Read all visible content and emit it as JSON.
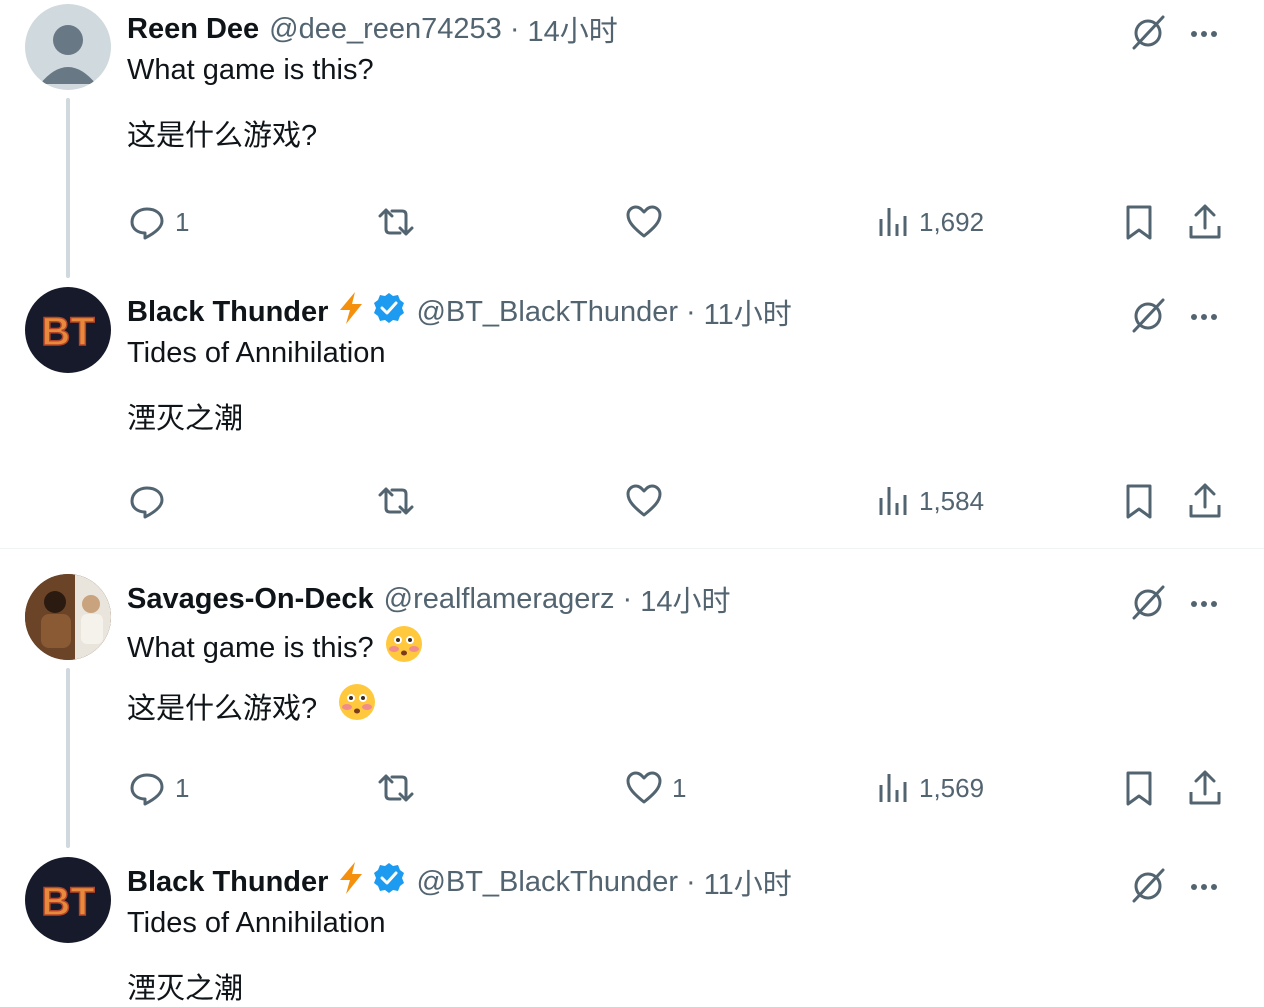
{
  "colors": {
    "icon_gray": "#536471",
    "verified_blue": "#1d9bf0",
    "bolt_orange": "#f4900c",
    "thread_line": "#cfd9de",
    "text": "#0f1419"
  },
  "tweets": [
    {
      "name": "Reen Dee",
      "handle": "@dee_reen74253",
      "dot": "·",
      "time": "14小时",
      "line1": "What game is this?",
      "line2": "这是什么游戏?",
      "reply_count": "1",
      "retweet_count": "",
      "like_count": "",
      "views": "1,692",
      "avatar": "default-avatar",
      "verified": false,
      "emoji": false
    },
    {
      "name": "Black Thunder",
      "handle": "@BT_BlackThunder",
      "dot": "·",
      "time": "11小时",
      "line1": "Tides of Annihilation",
      "line2": "湮灭之潮",
      "reply_count": "",
      "retweet_count": "",
      "like_count": "",
      "views": "1,584",
      "avatar": "bt-logo",
      "verified": true,
      "emoji": false
    },
    {
      "name": "Savages-On-Deck",
      "handle": "@realflameragerz",
      "dot": "·",
      "time": "14小时",
      "line1": "What game is this?",
      "line2": "这是什么游戏?",
      "reply_count": "1",
      "retweet_count": "",
      "like_count": "1",
      "views": "1,569",
      "avatar": "photo-avatar",
      "verified": false,
      "emoji": true
    },
    {
      "name": "Black Thunder",
      "handle": "@BT_BlackThunder",
      "dot": "·",
      "time": "11小时",
      "line1": "Tides of Annihilation",
      "line2": "湮灭之潮",
      "avatar": "bt-logo",
      "verified": true,
      "emoji": false
    }
  ],
  "bt_logo_text": "BT"
}
